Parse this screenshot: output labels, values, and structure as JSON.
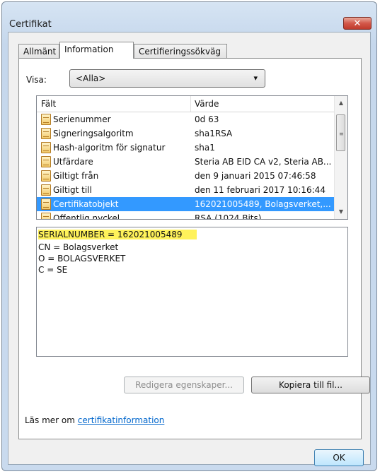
{
  "window": {
    "title": "Certifikat",
    "close_label": "✕"
  },
  "tabs": [
    {
      "label": "Allmänt",
      "active": false
    },
    {
      "label": "Information",
      "active": true
    },
    {
      "label": "Certifieringssökväg",
      "active": false
    }
  ],
  "visa": {
    "label": "Visa:",
    "value": "<Alla>",
    "arrow": "▾"
  },
  "fields": {
    "headers": {
      "field": "Fält",
      "value": "Värde"
    },
    "rows": [
      {
        "field": "Serienummer",
        "value": "0d 63",
        "selected": false
      },
      {
        "field": "Signeringsalgoritm",
        "value": "sha1RSA",
        "selected": false
      },
      {
        "field": "Hash-algoritm för signatur",
        "value": "sha1",
        "selected": false
      },
      {
        "field": "Utfärdare",
        "value": "Steria AB EID CA v2, Steria AB...",
        "selected": false
      },
      {
        "field": "Giltigt från",
        "value": "den 9 januari 2015 07:46:58",
        "selected": false
      },
      {
        "field": "Giltigt till",
        "value": "den 11 februari 2017 10:16:44",
        "selected": false
      },
      {
        "field": "Certifikatobjekt",
        "value": "162021005489, Bolagsverket,...",
        "selected": true
      },
      {
        "field": "Offentlig nyckel",
        "value": "RSA (1024 Bits)",
        "selected": false
      }
    ],
    "icon_name": "certificate-field-icon"
  },
  "detail": {
    "highlighted_line": "SERIALNUMBER = 162021005489",
    "lines": [
      "CN = Bolagsverket",
      "O = BOLAGSVERKET",
      "C = SE"
    ],
    "highlight_color": "#fff25a"
  },
  "buttons": {
    "edit_properties": "Redigera egenskaper...",
    "copy_to_file": "Kopiera till fil...",
    "ok": "OK"
  },
  "learn_more": {
    "prefix": "Läs mer om ",
    "link": "certifikatinformation"
  },
  "colors": {
    "selection": "#3399ff",
    "link": "#0066cc",
    "close": "#c03b2c"
  }
}
